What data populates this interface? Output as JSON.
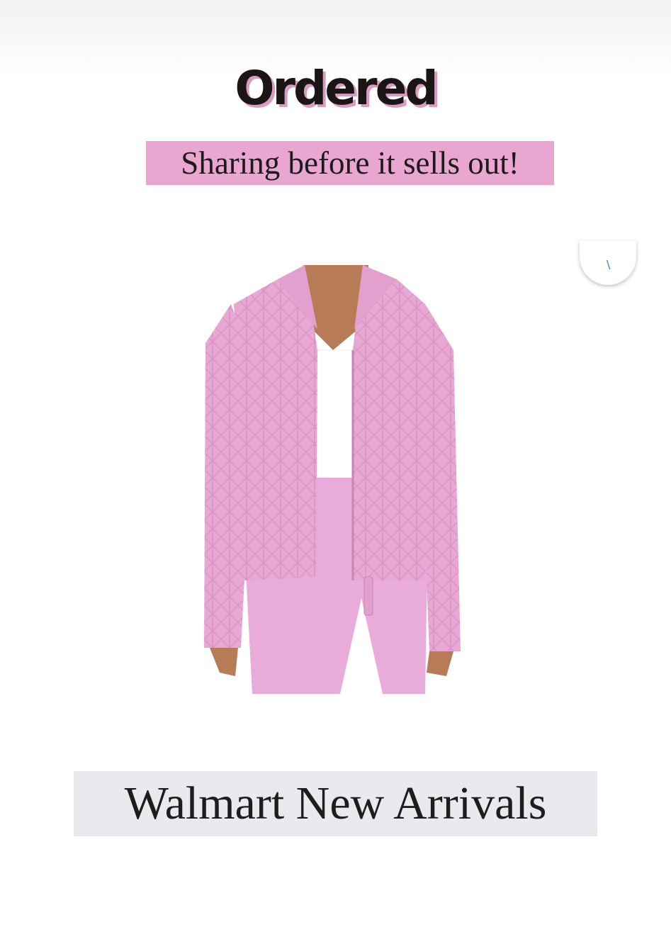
{
  "headline": "Ordered",
  "subtitle": "Sharing before it sells out!",
  "footer": "Walmart New Arrivals",
  "product": {
    "image": "pink-quilted-jacket",
    "colors": {
      "jacket": "#e8a8d4",
      "leggings": "#e9abd9",
      "top": "#ffffff",
      "skin": "#b77b55"
    }
  },
  "colors": {
    "highlight": "#e8a6d1",
    "footer_bg": "#e9e9ee",
    "text": "#1c1516"
  }
}
